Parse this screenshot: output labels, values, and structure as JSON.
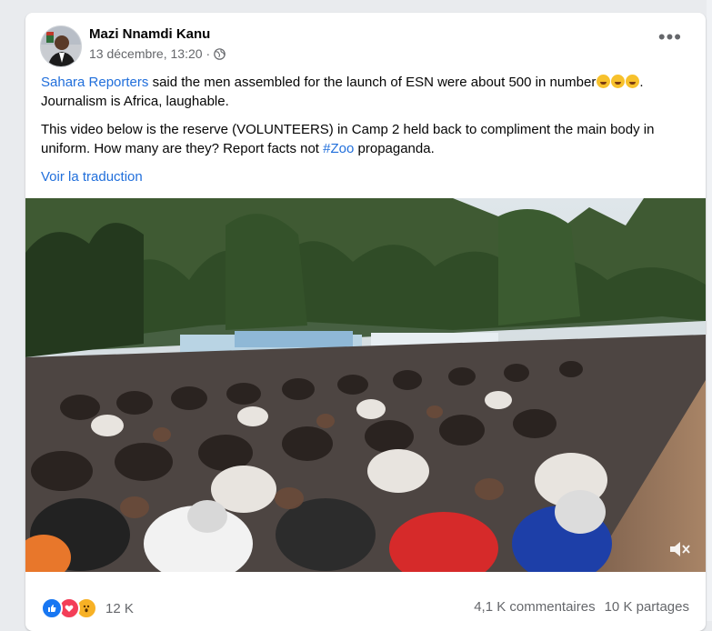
{
  "post": {
    "author": "Mazi Nnamdi Kanu",
    "date": "13 décembre, 13:20",
    "separator": "·",
    "privacy_icon": "globe-icon",
    "more_label": "•••",
    "paragraph1": {
      "link": "Sahara Reporters",
      "text": " said the men assembled for the launch of ESN were about 500 in number",
      "emojis": [
        "rolling-laughing",
        "rolling-laughing",
        "rolling-laughing"
      ],
      "after_emoji": ".",
      "line2": "Journalism is Africa, laughable."
    },
    "paragraph2": {
      "text": "This video below is the reserve (VOLUNTEERS) in Camp 2 held back to compliment the main body in uniform. How many are they? Report facts not ",
      "hashtag": "#Zoo",
      "after": " propaganda."
    },
    "translate_label": "Voir la traduction",
    "video": {
      "description_icon": "mute-icon"
    },
    "reactions": {
      "types": [
        "like",
        "love",
        "wow"
      ],
      "count": "12 K"
    },
    "comments": "4,1 K commentaires",
    "shares": "10 K partages"
  },
  "colors": {
    "link": "#216fdb",
    "secondary_text": "#65676b",
    "like": "#1877f2",
    "love": "#f33e58",
    "wow": "#f7b125"
  }
}
